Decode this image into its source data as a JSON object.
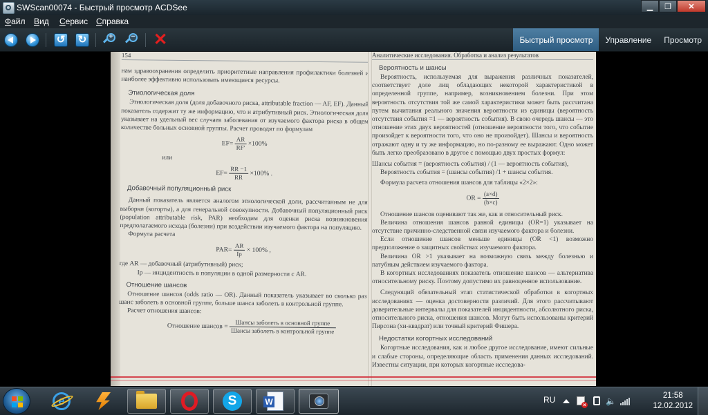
{
  "window": {
    "title": "SWScan00074 - Быстрый просмотр ACDSee"
  },
  "menu": [
    "Файл",
    "Вид",
    "Сервис",
    "Справка"
  ],
  "menu_underline": [
    "Ф",
    "В",
    "С",
    "С"
  ],
  "menu_rest": [
    "айл",
    "ид",
    "ервис",
    "правка"
  ],
  "modes": {
    "quick_view": "Быстрый просмотр",
    "manage": "Управление",
    "view": "Просмотр"
  },
  "toolbar_icons": [
    "back-arrow-icon",
    "forward-arrow-icon",
    "rotate-left-icon",
    "rotate-right-icon",
    "zoom-in-icon",
    "zoom-out-icon",
    "delete-icon"
  ],
  "left_page": {
    "page_number": "154",
    "p0": "нам здравоохранения определить приоритетные направления профилактики болезней и наиболее эффективно использовать имеющиеся ресурсы.",
    "h1": "Этиологическая доля",
    "p1": "Этиологическая доля (доля добавочного риска, attributable fraction — AF, EF). Данный показатель содержит ту же информацию, что и атрибутивный риск. Этиологическая доля указывает на удельный вес случаев заболевания от изучаемого фактора риска в общем количестве больных основной группы. Расчет проводят по формулам",
    "f1_left": "EF=",
    "f1_num": "AR",
    "f1_den": "RF'",
    "f1_right": "×100%",
    "or_text": "или",
    "f2_left": "EF=",
    "f2_num": "RR −1",
    "f2_den": "RR",
    "f2_right": "×100% .",
    "h2": "Добавочный популяционный риск",
    "p2": "Данный показатель является аналогом этиологической доли, рассчитанным не для выборки (когорты), а для генеральной совокупности. Добавочный популяционный риск (population attributable risk, PAR) необходим для оценки риска возникновения предполагаемого исхода (болезни) при воздействии изучаемого фактора на популяцию.",
    "p3": "Формула расчета",
    "f3_left": "PAR=",
    "f3_num": "AR",
    "f3_den": "Ip",
    "f3_right": "× 100% ,",
    "where1": "где  AR — добавочный (атрибутивный) риск;",
    "where2": "Ip — инцидентность в популяции в одной размерности с AR.",
    "h3": "Отношение шансов",
    "p4": "Отношение шансов (odds ratio — OR). Данный показатель указывает во сколько раз шанс заболеть в основной группе, больше шанса заболеть в контрольной группе.",
    "p5": "Расчет отношения шансов:",
    "f4_left": "Отношение шансов =",
    "f4_num": "Шансы заболеть в основной группе",
    "f4_den": "Шансы заболеть в контрольной группе"
  },
  "right_page": {
    "running_head": "Аналитические исследования. Обработка и анализ результатов",
    "h1": "Вероятность и шансы",
    "p1": "Вероятность, используемая для выражения различных показателей, соответствует доле лиц обладающих некоторой характеристикой в определенной группе, например, возникновением болезни. При этом вероятность отсутствия той же самой характеристики может быть рассчитана путем вычитания реального значения вероятности из единицы (вероятность отсутствия события =1 — вероятность события). В свою очередь шансы — это отношение этих двух вероятностей (отношение вероятности того, что событие произойдет к вероятности того, что оно не произойдет). Шансы и вероятность отражают одну и ту же информацию, но по-разному ее выражают. Одно может быть легко преобразовано в другое с помощью двух простых формул:",
    "f1": "Шансы события = (вероятность события) / (1 — вероятность события),",
    "f2": "Вероятность события = (шансы события) /1 + шансы события.",
    "p2": "Формула расчета отношения шансов для таблицы «2×2»:",
    "f3_left": "OR =",
    "f3_num": "(a×d)",
    "f3_den": "(b×c)",
    "p3": "Отношение шансов оценивают так же, как и относительный риск.",
    "p4": "Величина отношения шансов равной единицы (OR=1) указывает на отсутствие причинно-следственной связи изучаемого фактора и болезни.",
    "p5": "Если отношение шансов меньше единицы (OR <1) возможно предположение о защитных свойствах изучаемого фактора.",
    "p6": "Величина OR >1 указывает на возможную связь между болезнью и патубным действием изучаемого фактора.",
    "p7": "В когортных исследованиях показатель отношение шансов — альтернатива относительному риску. Поэтому допустимо их равноценное использование.",
    "p8": "Следующий обязательный этап статистической обработки в когортных исследованиях — оценка достоверности различий. Для этого рассчитывают доверительные интервалы для показателей инцидентности, абсолютного риска, относительного риска, отношения шансов. Могут быть использованы критерий Пирсона (хи-квадрат) или точный критерий Фишера.",
    "h2": "Недостатки когортных исследований",
    "p9": "Когортные исследования, как и любое другое исследование, имеют сильные и слабые стороны, определяющие область применения данных исследований. Известны ситуации, при которых когортные исследова-"
  },
  "taskbar": {
    "apps": [
      "internet-explorer-icon",
      "winamp-icon",
      "explorer-folder-icon",
      "opera-icon",
      "skype-icon",
      "word-icon",
      "acdsee-icon"
    ],
    "language": "RU",
    "time": "21:58",
    "date": "12.02.2012"
  },
  "colors": {
    "title_bar": "#1a252c",
    "active_mode": "#2d5c81",
    "close_button": "#c0392b",
    "scan_paper": "#e6e3da",
    "red_line": "#d02a36"
  }
}
